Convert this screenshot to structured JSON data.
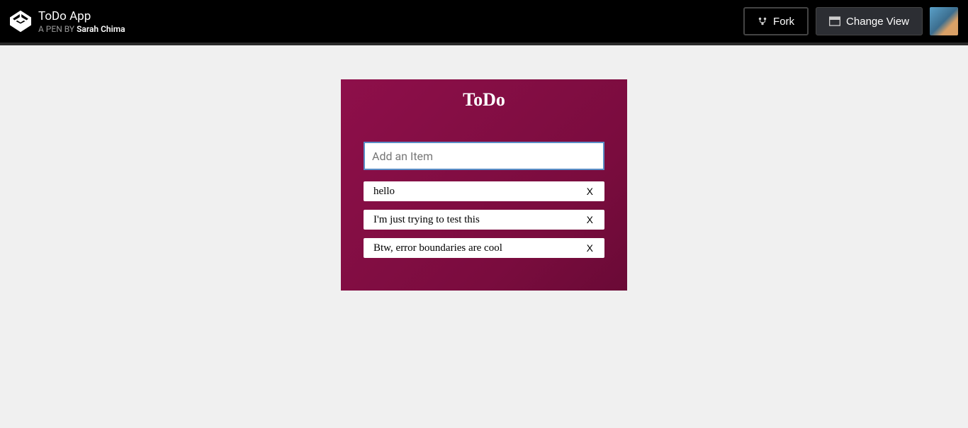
{
  "header": {
    "title": "ToDo App",
    "subtitle_prefix": "A PEN BY ",
    "author": "Sarah Chima",
    "fork_label": "Fork",
    "change_view_label": "Change View"
  },
  "todo": {
    "title": "ToDo",
    "input_placeholder": "Add an Item",
    "input_value": "",
    "delete_symbol": "X",
    "items": [
      {
        "text": "hello"
      },
      {
        "text": "I'm just trying to test this"
      },
      {
        "text": "Btw, error boundaries are cool"
      }
    ]
  }
}
